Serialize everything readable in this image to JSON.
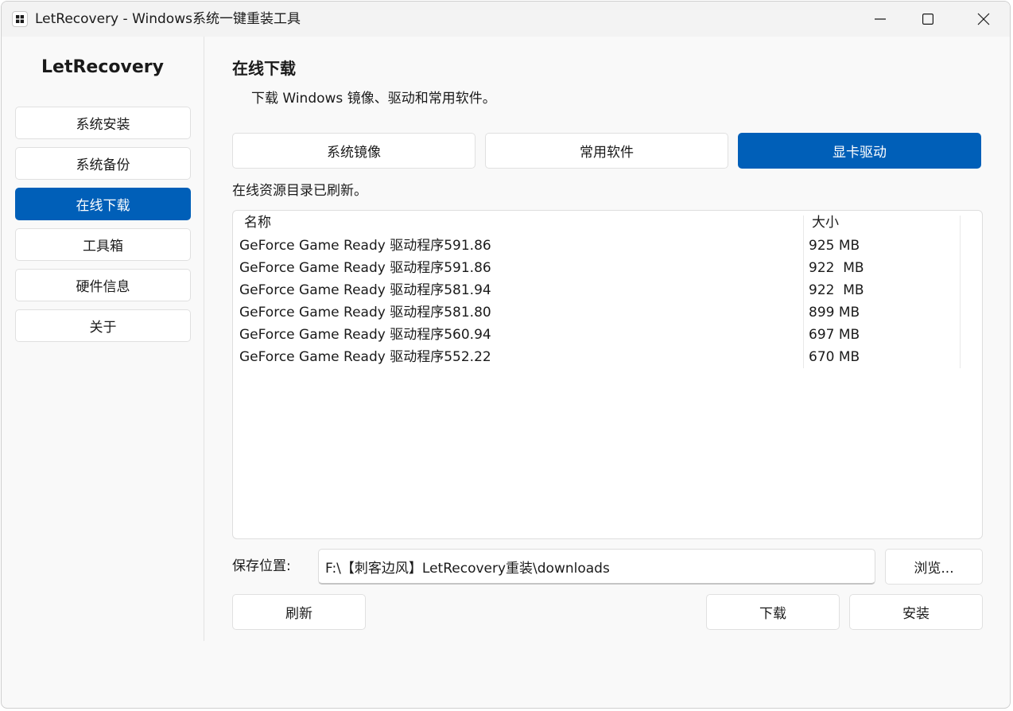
{
  "window": {
    "title": "LetRecovery - Windows系统一键重装工具"
  },
  "sidebar": {
    "app_name": "LetRecovery",
    "items": [
      {
        "label": "系统安装",
        "active": false
      },
      {
        "label": "系统备份",
        "active": false
      },
      {
        "label": "在线下载",
        "active": true
      },
      {
        "label": "工具箱",
        "active": false
      },
      {
        "label": "硬件信息",
        "active": false
      },
      {
        "label": "关于",
        "active": false
      }
    ]
  },
  "main": {
    "title": "在线下载",
    "subtitle": "下载 Windows 镜像、驱动和常用软件。",
    "tabs": [
      {
        "label": "系统镜像",
        "active": false
      },
      {
        "label": "常用软件",
        "active": false
      },
      {
        "label": "显卡驱动",
        "active": true
      }
    ],
    "status": "在线资源目录已刷新。",
    "table": {
      "columns": [
        "名称",
        "大小"
      ],
      "rows": [
        {
          "name": "GeForce Game Ready 驱动程序591.86",
          "size": "925 MB"
        },
        {
          "name": "GeForce Game Ready 驱动程序591.86",
          "size": "922  MB"
        },
        {
          "name": "GeForce Game Ready 驱动程序581.94",
          "size": "922  MB"
        },
        {
          "name": "GeForce Game Ready 驱动程序581.80",
          "size": "899 MB"
        },
        {
          "name": "GeForce Game Ready 驱动程序560.94",
          "size": "697 MB"
        },
        {
          "name": "GeForce Game Ready 驱动程序552.22",
          "size": "670 MB"
        }
      ]
    },
    "save": {
      "label": "保存位置:",
      "path": "F:\\【刺客边风】LetRecovery重装\\downloads",
      "browse_label": "浏览..."
    },
    "actions": {
      "refresh_label": "刷新",
      "download_label": "下载",
      "install_label": "安装"
    }
  },
  "colors": {
    "accent": "#005fb8",
    "background": "#f9f9f9",
    "titlebar": "#f3f3f3"
  }
}
